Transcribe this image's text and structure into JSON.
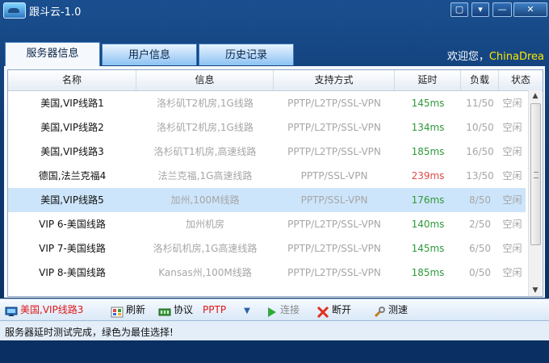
{
  "window": {
    "title": "跟斗云-1.0"
  },
  "titlebar_buttons": [
    {
      "icon": "chat-icon",
      "glyph": "▢"
    },
    {
      "icon": "menu-icon",
      "glyph": "▾"
    },
    {
      "icon": "minimize-icon",
      "glyph": "—"
    },
    {
      "icon": "close-icon",
      "glyph": "✕"
    }
  ],
  "tabs": [
    {
      "label": "服务器信息",
      "active": true
    },
    {
      "label": "用户信息",
      "active": false
    },
    {
      "label": "历史记录",
      "active": false
    }
  ],
  "welcome": {
    "text": "欢迎您，",
    "user": "ChinaDrea"
  },
  "table": {
    "columns": [
      "名称",
      "信息",
      "支持方式",
      "延时",
      "负载",
      "状态"
    ],
    "rows": [
      {
        "name": "美国,VIP线路1",
        "info": "洛杉矶T2机房,1G线路",
        "protocol": "PPTP/L2TP/SSL-VPN",
        "latency": "145ms",
        "load": "11/50",
        "status": "空闲",
        "latency_color": "#2e9a3a"
      },
      {
        "name": "美国,VIP线路2",
        "info": "洛杉矶T2机房,1G线路",
        "protocol": "PPTP/L2TP/SSL-VPN",
        "latency": "134ms",
        "load": "10/50",
        "status": "空闲",
        "latency_color": "#2e9a3a"
      },
      {
        "name": "美国,VIP线路3",
        "info": "洛杉矶T1机房,高速线路",
        "protocol": "PPTP/L2TP/SSL-VPN",
        "latency": "185ms",
        "load": "16/50",
        "status": "空闲",
        "latency_color": "#2e9a3a"
      },
      {
        "name": "德国,法兰克福4",
        "info": "法兰克福,1G高速线路",
        "protocol": "PPTP/SSL-VPN",
        "latency": "239ms",
        "load": "13/50",
        "status": "空闲",
        "latency_color": "#e04848"
      },
      {
        "name": "美国,VIP线路5",
        "info": "加州,100M线路",
        "protocol": "PPTP/SSL-VPN",
        "latency": "176ms",
        "load": "8/50",
        "status": "空闲",
        "latency_color": "#2e9a3a",
        "selected": true
      },
      {
        "name": "VIP 6-美国线路",
        "info": "加州机房",
        "protocol": "PPTP/L2TP/SSL-VPN",
        "latency": "140ms",
        "load": "2/50",
        "status": "空闲",
        "latency_color": "#2e9a3a"
      },
      {
        "name": "VIP 7-美国线路",
        "info": "洛杉矶机房,1G高速线路",
        "protocol": "PPTP/L2TP/SSL-VPN",
        "latency": "145ms",
        "load": "6/50",
        "status": "空闲",
        "latency_color": "#2e9a3a"
      },
      {
        "name": "VIP 8-美国线路",
        "info": "Kansas州,100M线路",
        "protocol": "PPTP/L2TP/SSL-VPN",
        "latency": "185ms",
        "load": "0/50",
        "status": "空闲",
        "latency_color": "#2e9a3a"
      }
    ]
  },
  "toolbar": {
    "server": "美国,VIP线路3",
    "refresh": "刷新",
    "protocol_label": "协议",
    "protocol_value": "PPTP",
    "connect": "连接",
    "disconnect": "断开",
    "speedtest": "测速"
  },
  "statusbar": {
    "text": "服务器延时测试完成，绿色为最佳选择!"
  }
}
